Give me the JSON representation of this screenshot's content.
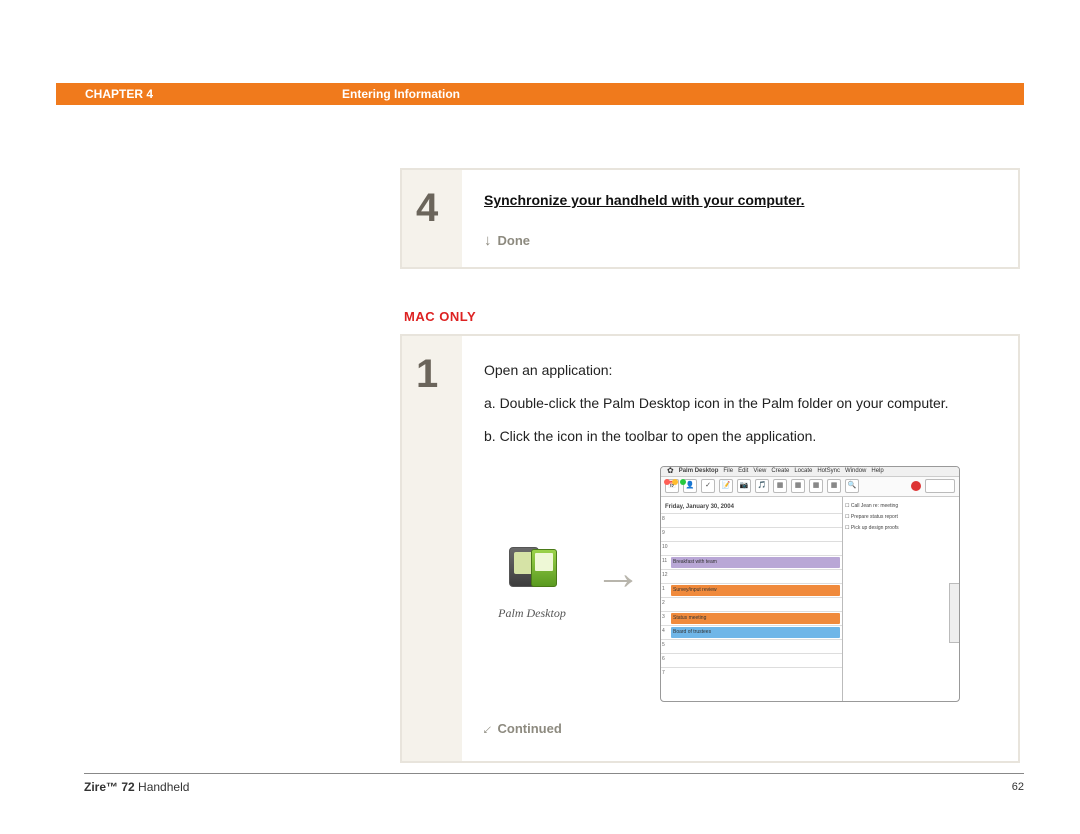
{
  "header": {
    "chapter": "CHAPTER 4",
    "title": "Entering Information"
  },
  "step4": {
    "number": "4",
    "link_text": "Synchronize your handheld with your computer.",
    "done_label": "Done"
  },
  "mac_only_label": "MAC ONLY",
  "step1": {
    "number": "1",
    "intro": "Open an application:",
    "item_a": "a.  Double-click the Palm Desktop icon in the Palm folder on your computer.",
    "item_b": "b.  Click the icon in the toolbar to open the application.",
    "palm_desktop_caption": "Palm Desktop",
    "continued_label": "Continued"
  },
  "appshot": {
    "app_name": "Palm Desktop",
    "menus": [
      "File",
      "Edit",
      "View",
      "Create",
      "Locate",
      "HotSync",
      "Window",
      "Help"
    ],
    "date_label": "Friday, January 30, 2004",
    "events": [
      {
        "slot": 3,
        "color": "#b9a7d6",
        "text": "Breakfast with team"
      },
      {
        "slot": 5,
        "color": "#f08a3c",
        "text": "Survey/input review"
      },
      {
        "slot": 7,
        "color": "#f08a3c",
        "text": "Status meeting"
      },
      {
        "slot": 8,
        "color": "#6fb6e8",
        "text": "Board of trustees"
      }
    ],
    "tasks": [
      "Call Jean re: meeting",
      "Prepare status report",
      "Pick up design proofs"
    ]
  },
  "footer": {
    "product_bold": "Zire™ 72",
    "product_rest": " Handheld",
    "page": "62"
  }
}
